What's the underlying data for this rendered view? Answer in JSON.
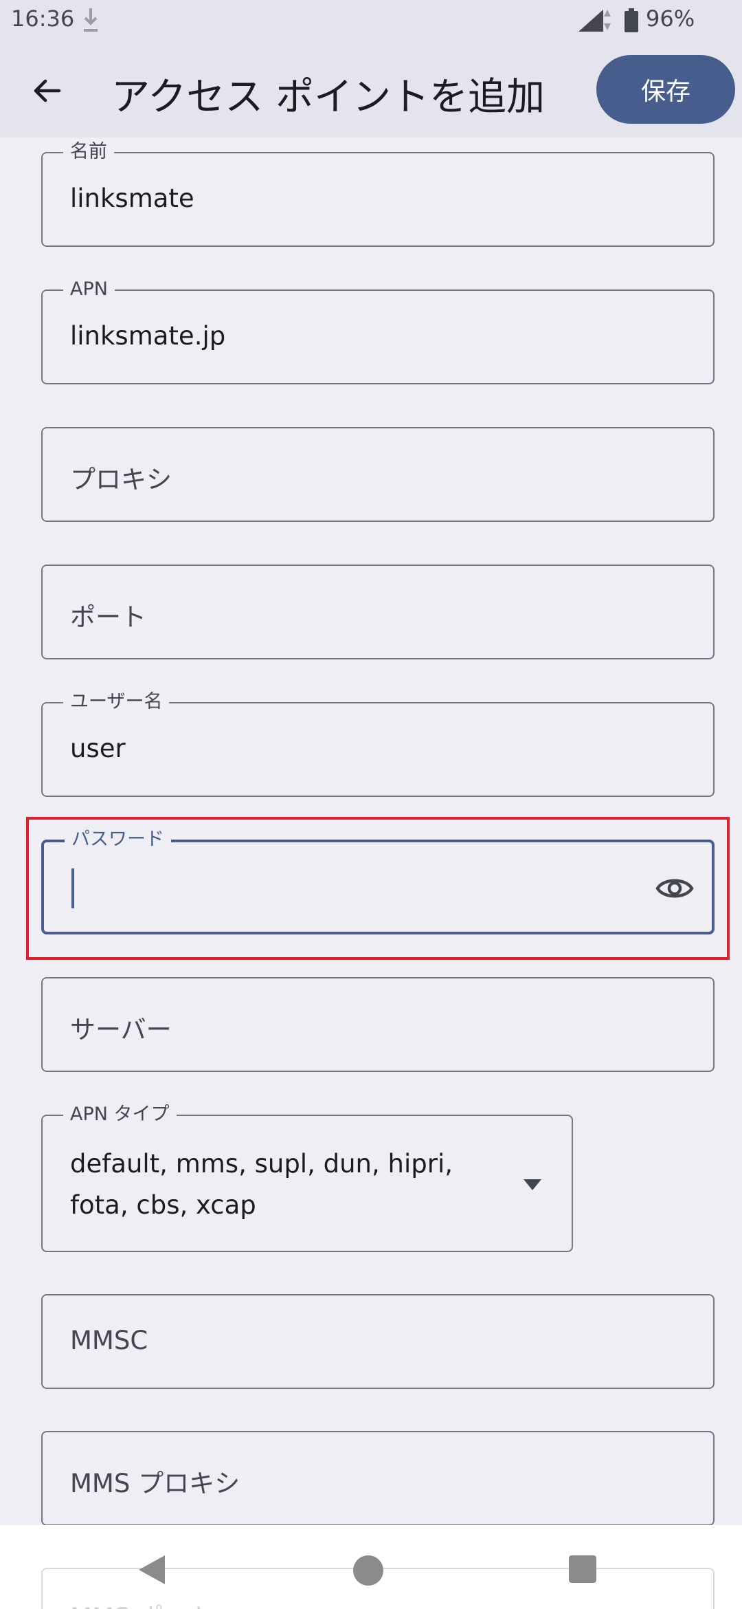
{
  "status_bar": {
    "time": "16:36",
    "battery": "96%"
  },
  "app_bar": {
    "title": "アクセス ポイントを追加",
    "save_label": "保存"
  },
  "fields": {
    "name": {
      "label": "名前",
      "value": "linksmate"
    },
    "apn": {
      "label": "APN",
      "value": "linksmate.jp"
    },
    "proxy": {
      "placeholder": "プロキシ"
    },
    "port": {
      "placeholder": "ポート"
    },
    "username": {
      "label": "ユーザー名",
      "value": "user"
    },
    "password": {
      "label": "パスワード",
      "value": ""
    },
    "server": {
      "placeholder": "サーバー"
    },
    "apn_type": {
      "label": "APN タイプ",
      "value_line1": "default, mms, supl, dun, hipri,",
      "value_line2": "fota, cbs, xcap"
    },
    "mmsc": {
      "placeholder": "MMSC"
    },
    "mms_proxy": {
      "placeholder": "MMS プロキシ"
    },
    "mms_port": {
      "placeholder": "MMS ポート"
    }
  },
  "colors": {
    "accent": "#475d8e",
    "highlight": "#e2202a",
    "background": "#eeeef4"
  }
}
